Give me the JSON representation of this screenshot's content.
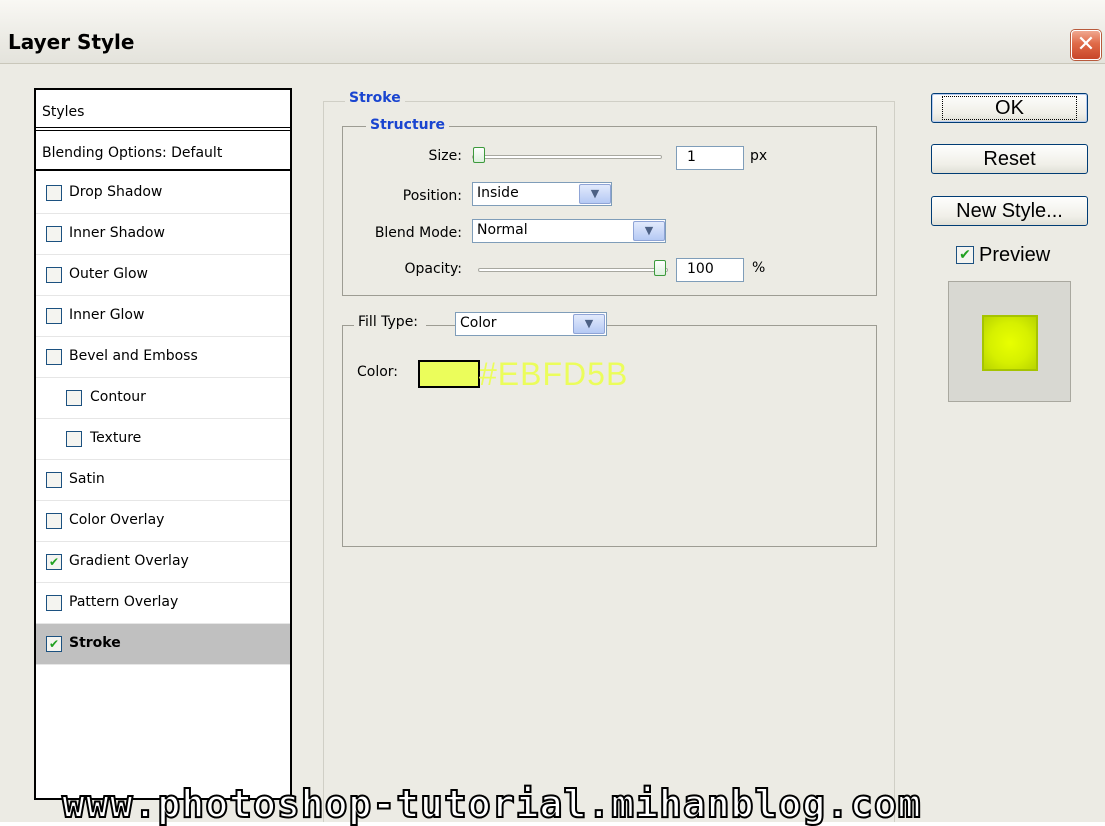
{
  "window": {
    "title": "Layer Style",
    "close_glyph": "✕"
  },
  "styles_panel": {
    "header": "Styles",
    "blending_options": "Blending Options: Default",
    "items": [
      {
        "label": "Drop Shadow",
        "checked": false
      },
      {
        "label": "Inner Shadow",
        "checked": false
      },
      {
        "label": "Outer Glow",
        "checked": false
      },
      {
        "label": "Inner Glow",
        "checked": false
      },
      {
        "label": "Bevel and Emboss",
        "checked": false
      },
      {
        "label": "Contour",
        "checked": false
      },
      {
        "label": "Texture",
        "checked": false
      },
      {
        "label": "Satin",
        "checked": false
      },
      {
        "label": "Color Overlay",
        "checked": false
      },
      {
        "label": "Gradient Overlay",
        "checked": true
      },
      {
        "label": "Pattern Overlay",
        "checked": false
      },
      {
        "label": "Stroke",
        "checked": true,
        "selected": true
      }
    ]
  },
  "stroke": {
    "legend": "Stroke",
    "structure": {
      "legend": "Structure",
      "size_label": "Size:",
      "size_value": "1",
      "size_unit": "px",
      "position_label": "Position:",
      "position_value": "Inside",
      "blend_mode_label": "Blend Mode:",
      "blend_mode_value": "Normal",
      "opacity_label": "Opacity:",
      "opacity_value": "100",
      "opacity_unit": "%"
    },
    "fill": {
      "fill_type_label": "Fill Type:",
      "fill_type_value": "Color",
      "color_label": "Color:",
      "color_value": "#EBFD5B"
    }
  },
  "buttons": {
    "ok": "OK",
    "reset": "Reset",
    "new_style": "New Style..."
  },
  "preview": {
    "label": "Preview",
    "checked": true
  },
  "watermark": "www.photoshop-tutorial.mihanblog.com",
  "colors": {
    "stroke_color": "#ebfd5b",
    "preview_fill": "#dff500",
    "legend_blue": "#1a45d0"
  },
  "icons": {
    "checkbox_check": "✔",
    "dropdown_arrow": "▼"
  }
}
